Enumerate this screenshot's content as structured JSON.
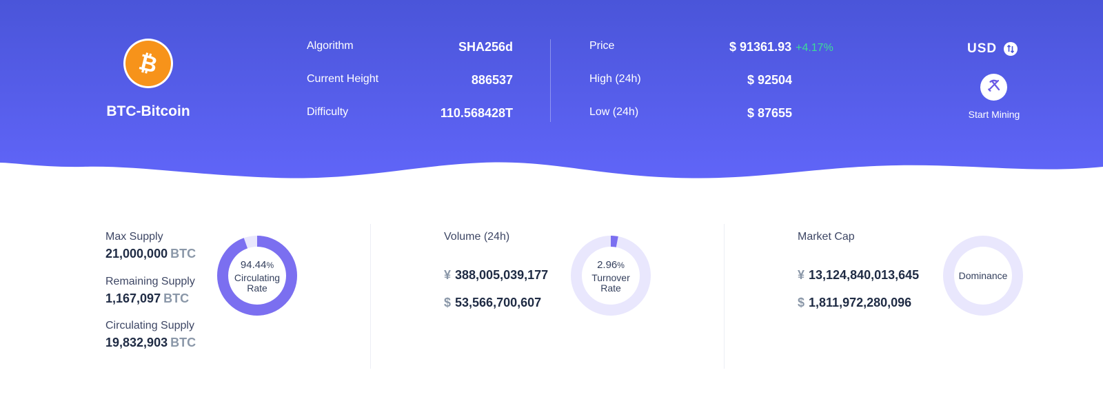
{
  "coin": {
    "name": "BTC-Bitcoin",
    "icon": "bitcoin-icon",
    "color": "#f7931a"
  },
  "stats_left": [
    {
      "label": "Algorithm",
      "value": "SHA256d"
    },
    {
      "label": "Current Height",
      "value": "886537"
    },
    {
      "label": "Difficulty",
      "value": "110.568428T"
    }
  ],
  "stats_right": [
    {
      "label": "Price",
      "value": "$ 91361.93",
      "change": "+4.17%"
    },
    {
      "label": "High (24h)",
      "value": "$ 92504"
    },
    {
      "label": "Low (24h)",
      "value": "$ 87655"
    }
  ],
  "currency": {
    "label": "USD",
    "icon": "swap-icon"
  },
  "mining": {
    "label": "Start Mining",
    "icon": "pickaxe-shovel-icon"
  },
  "supply": {
    "max_label": "Max Supply",
    "max_value": "21,000,000",
    "max_unit": "BTC",
    "remaining_label": "Remaining Supply",
    "remaining_value": "1,167,097",
    "remaining_unit": "BTC",
    "circulating_label": "Circulating Supply",
    "circulating_value": "19,832,903",
    "circulating_unit": "BTC",
    "donut_pct": "94.44",
    "donut_pct_sign": "%",
    "donut_cap1": "Circulating",
    "donut_cap2": "Rate",
    "donut_fraction": 0.9444
  },
  "volume": {
    "label": "Volume (24h)",
    "cny_symbol": "¥",
    "cny_value": "388,005,039,177",
    "usd_symbol": "$",
    "usd_value": "53,566,700,607",
    "donut_pct": "2.96",
    "donut_pct_sign": "%",
    "donut_cap1": "Turnover",
    "donut_cap2": "Rate",
    "donut_fraction": 0.0296
  },
  "market_cap": {
    "label": "Market Cap",
    "cny_symbol": "¥",
    "cny_value": "13,124,840,013,645",
    "usd_symbol": "$",
    "usd_value": "1,811,972,280,096",
    "donut_label": "Dominance"
  },
  "colors": {
    "hero_top": "#4a55d9",
    "hero_bottom": "#6065f8",
    "donut_fill": "#7b6ff0",
    "donut_track": "#e9e7fd",
    "price_up": "#3ddc97"
  }
}
